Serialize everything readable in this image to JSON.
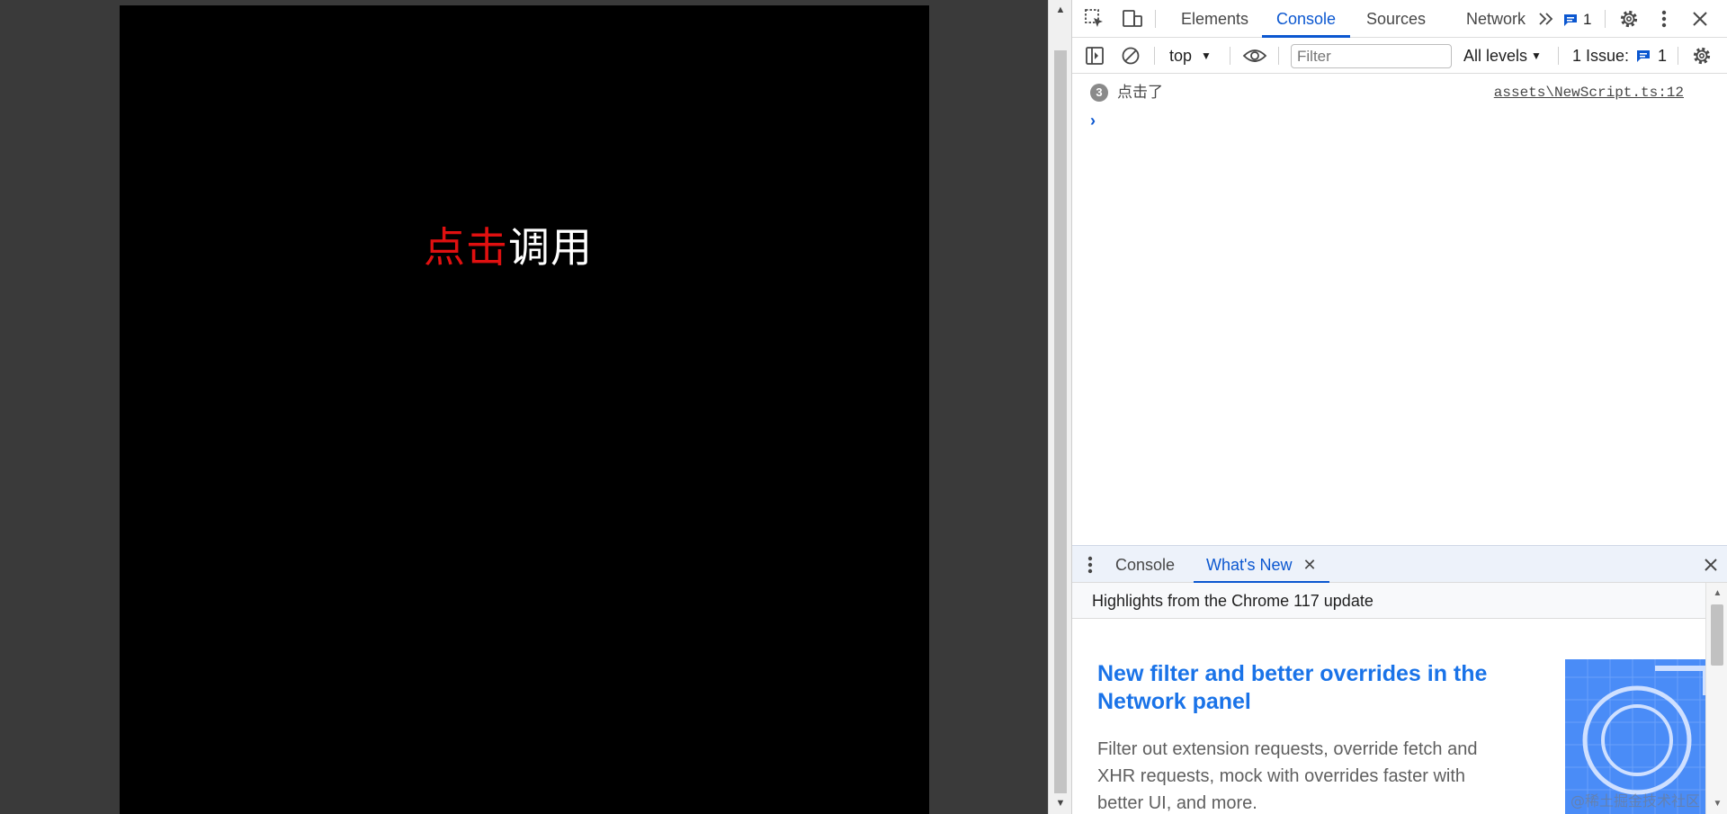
{
  "game": {
    "label_red": "点击",
    "label_white": "调用"
  },
  "devtools": {
    "tabs": [
      {
        "label": "Elements",
        "active": false
      },
      {
        "label": "Console",
        "active": true
      },
      {
        "label": "Sources",
        "active": false
      },
      {
        "label": "Network",
        "active": false
      }
    ],
    "messages_count": "1",
    "toolbar": {
      "context": "top",
      "filter_placeholder": "Filter",
      "levels": "All levels",
      "issues_label": "1 Issue:",
      "issues_count": "1"
    },
    "console": {
      "messages": [
        {
          "repeat": "3",
          "text": "点击了",
          "source": "assets\\NewScript.ts:12"
        }
      ],
      "prompt": "›"
    },
    "drawer": {
      "tabs": [
        {
          "label": "Console",
          "active": false
        },
        {
          "label": "What's New",
          "active": true
        }
      ],
      "header": "Highlights from the Chrome 117 update",
      "headline": "New filter and better overrides in the Network panel",
      "body": "Filter out extension requests, override fetch and XHR requests, mock with overrides faster with better UI, and more."
    },
    "watermark": "@稀土掘金技术社区"
  },
  "colors": {
    "accent": "#0b57d0",
    "label_red": "#e01010",
    "headline_blue": "#1a73e8"
  }
}
